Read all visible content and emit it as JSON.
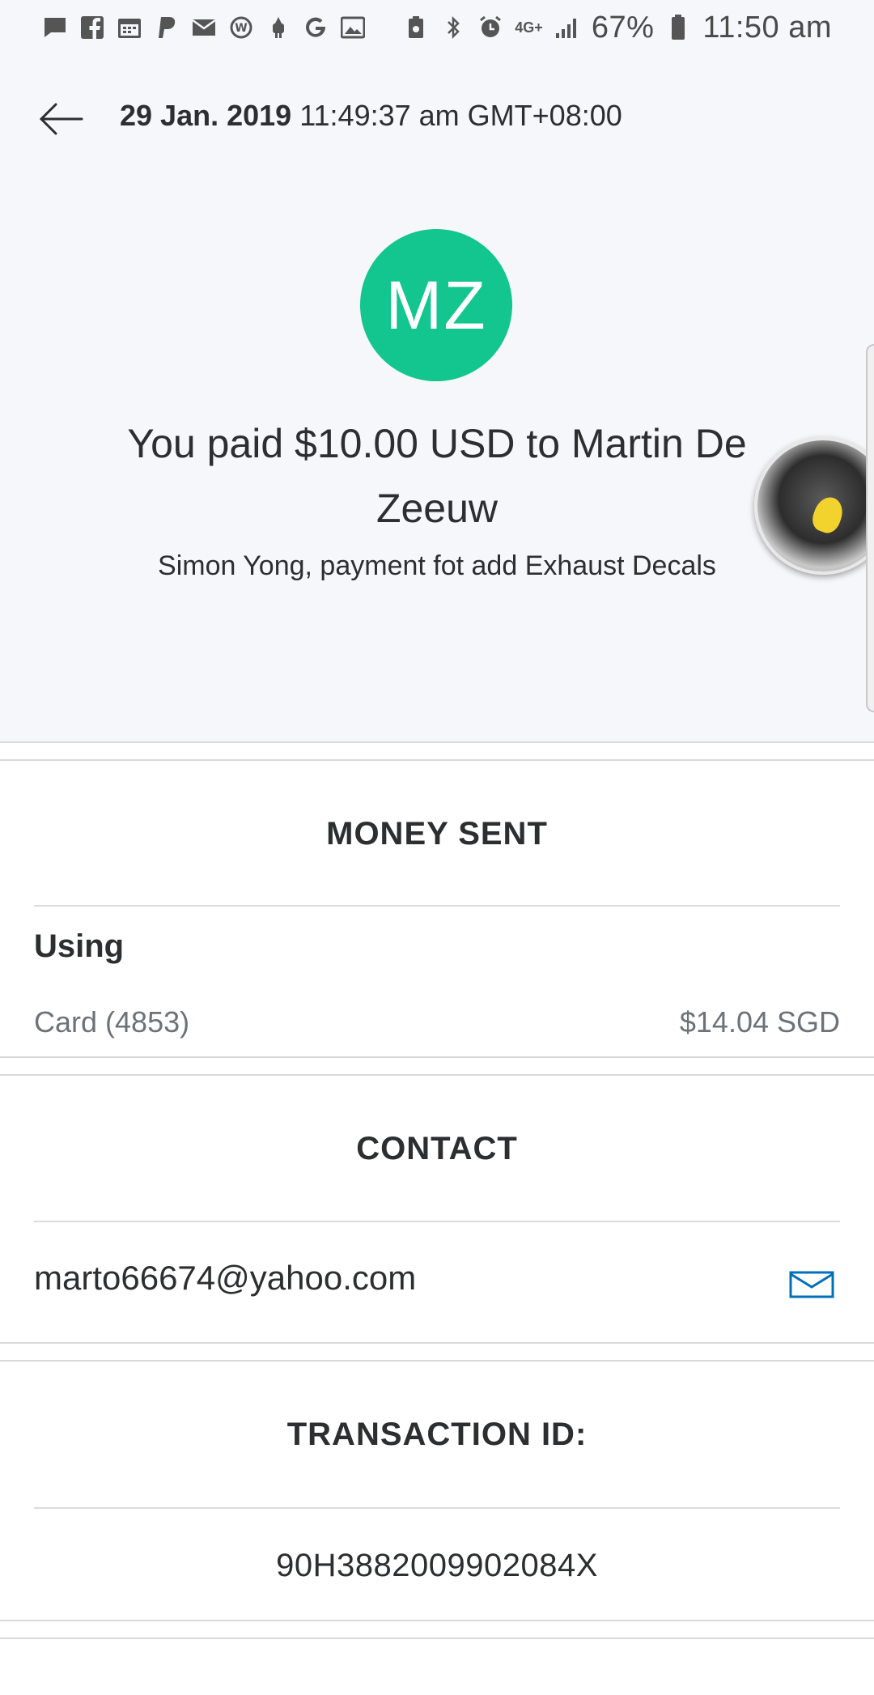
{
  "status_bar": {
    "left_icons": [
      "chat-icon",
      "facebook-icon",
      "calendar-icon",
      "paypal-icon",
      "mail-icon",
      "at-sign-icon",
      "android-icon",
      "google-icon",
      "image-icon"
    ],
    "network": "4G+",
    "battery": "67%",
    "time": "11:50 am"
  },
  "header": {
    "date": "29 Jan. 2019",
    "time": "11:49:37 am GMT+08:00"
  },
  "recipient": {
    "initials": "MZ",
    "avatar_color": "#13c58f"
  },
  "summary": {
    "title": "You paid $10.00 USD to Martin De Zeeuw",
    "note": "Simon Yong, payment fot add Exhaust Decals"
  },
  "money_sent": {
    "title": "MONEY SENT",
    "using_label": "Using",
    "card_label": "Card (4853)",
    "card_amount": "$14.04 SGD"
  },
  "contact": {
    "title": "CONTACT",
    "email": "marto66674@yahoo.com"
  },
  "transaction": {
    "title": "TRANSACTION ID:",
    "id": "90H3882009902084X"
  },
  "colors": {
    "accent": "#13c58f",
    "link_blue": "#0070ba"
  }
}
